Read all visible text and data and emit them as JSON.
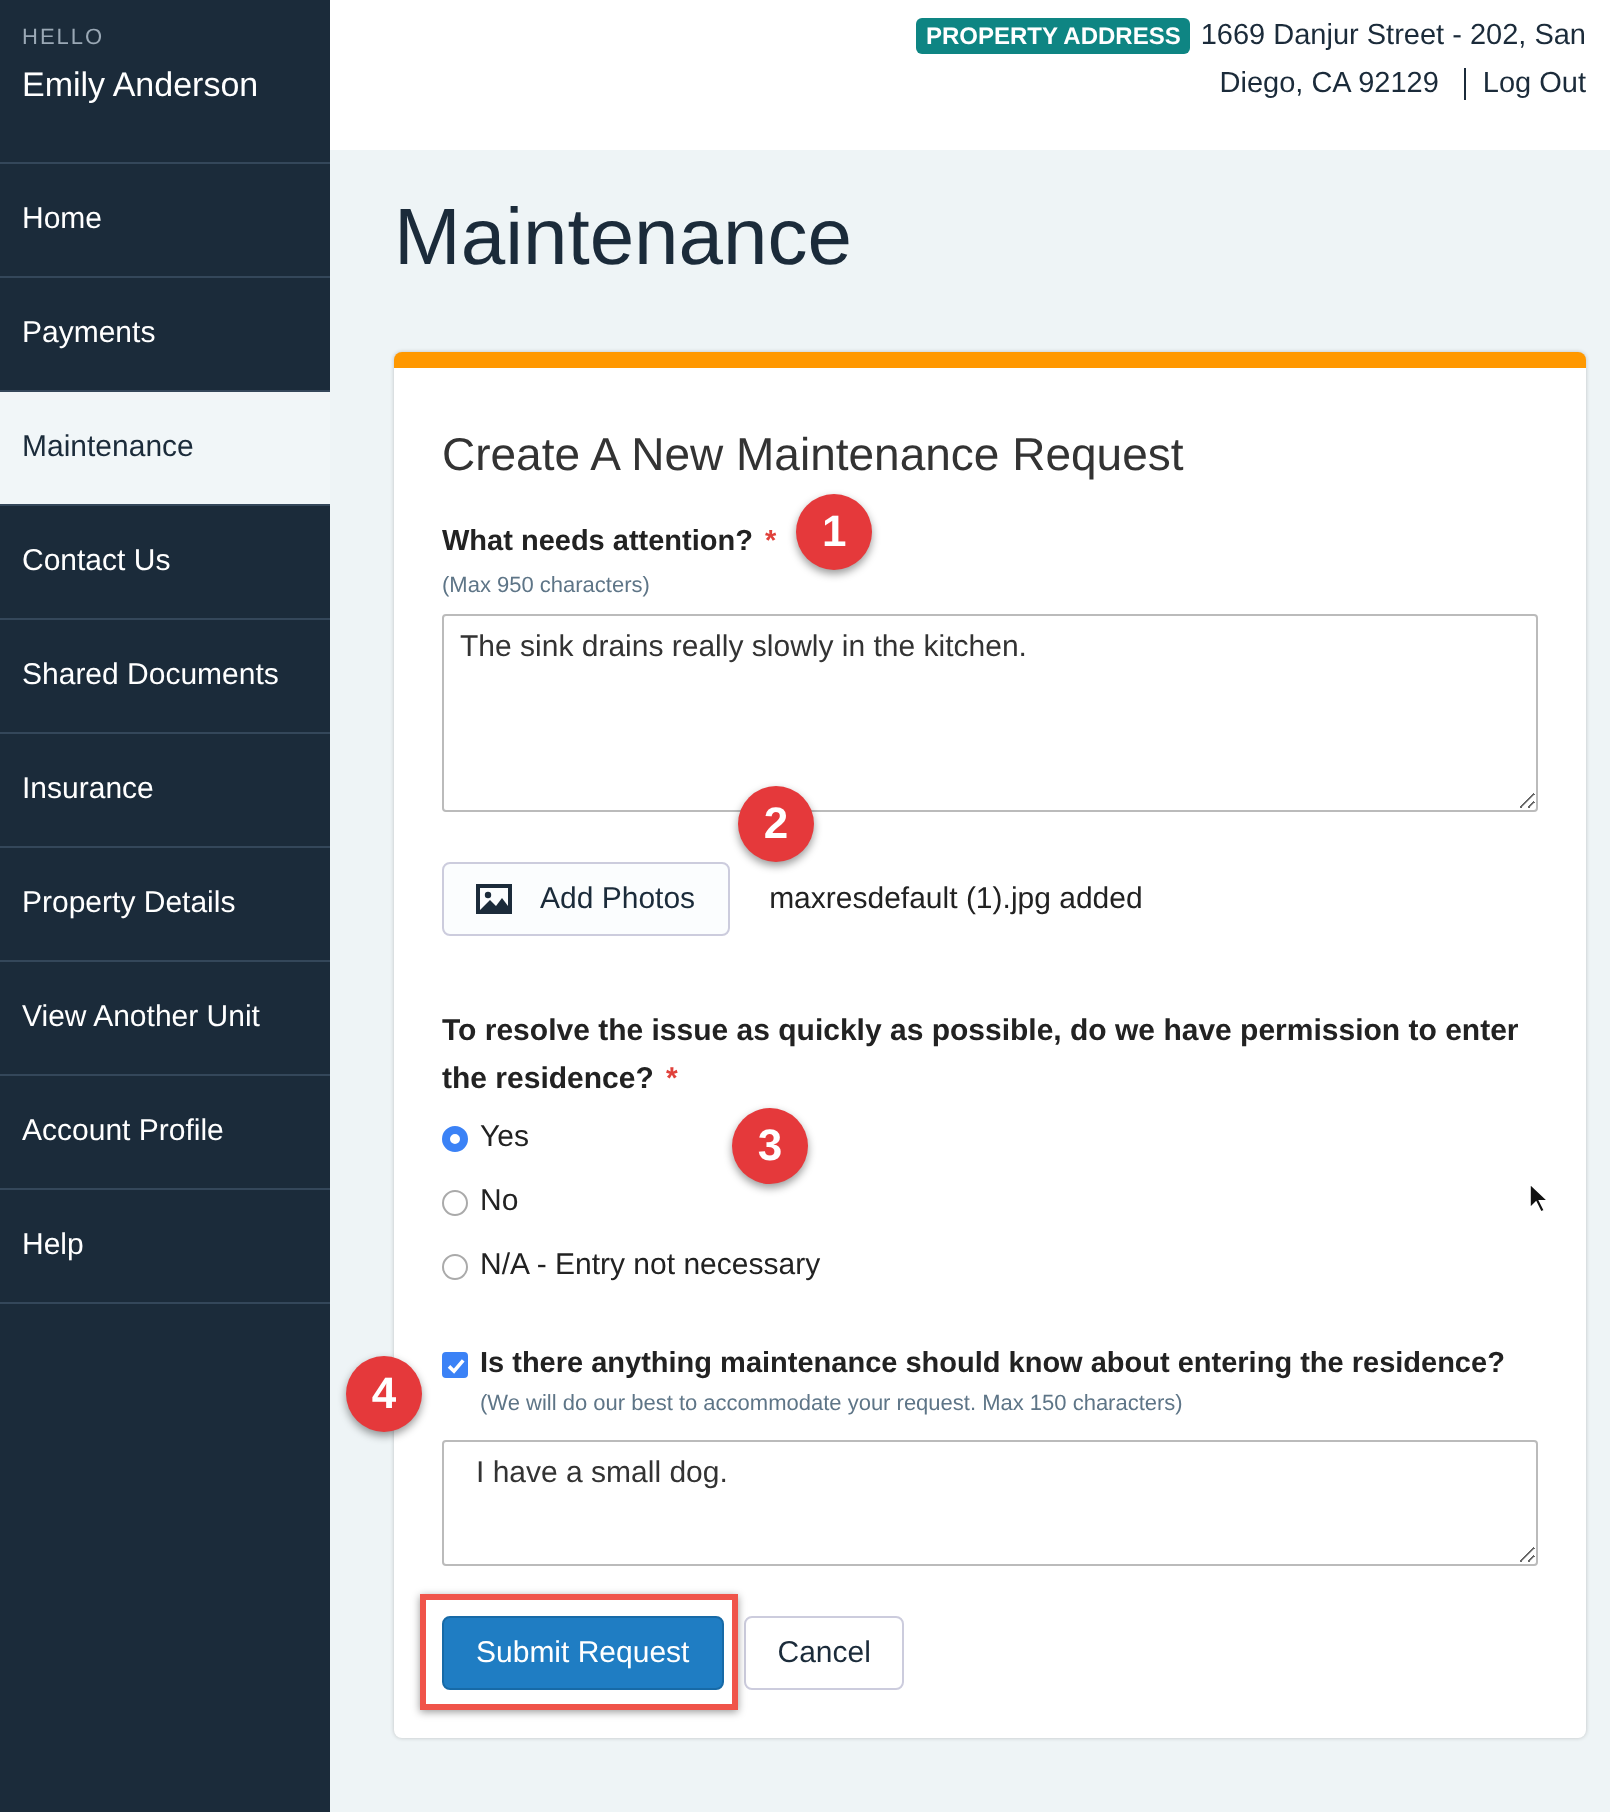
{
  "sidebar": {
    "greeting": "HELLO",
    "user_name": "Emily Anderson",
    "items": [
      {
        "label": "Home",
        "selected": false
      },
      {
        "label": "Payments",
        "selected": false
      },
      {
        "label": "Maintenance",
        "selected": true
      },
      {
        "label": "Contact Us",
        "selected": false
      },
      {
        "label": "Shared Documents",
        "selected": false
      },
      {
        "label": "Insurance",
        "selected": false
      },
      {
        "label": "Property Details",
        "selected": false
      },
      {
        "label": "View Another Unit",
        "selected": false
      },
      {
        "label": "Account Profile",
        "selected": false
      },
      {
        "label": "Help",
        "selected": false
      }
    ]
  },
  "header": {
    "badge": "PROPERTY ADDRESS",
    "address_lines": [
      "1669 Danjur Street - 202, San",
      "Diego, CA 92129"
    ],
    "logout": "Log Out"
  },
  "page_title": "Maintenance",
  "form": {
    "title": "Create A New Maintenance Request",
    "issue": {
      "label": "What needs attention?",
      "required_mark": "*",
      "hint": "(Max 950 characters)",
      "value": "The sink drains really slowly in the kitchen.",
      "annotation": "1"
    },
    "photos": {
      "button": "Add Photos",
      "status": "maxresdefault (1).jpg added",
      "annotation": "2"
    },
    "entry": {
      "label": "To resolve the issue as quickly as possible, do we have permission to enter the residence?",
      "required_mark": "*",
      "annotation": "3",
      "options": [
        {
          "label": "Yes",
          "selected": true
        },
        {
          "label": "No",
          "selected": false
        },
        {
          "label": "N/A - Entry not necessary",
          "selected": false
        }
      ]
    },
    "notes": {
      "checked": true,
      "label": "Is there anything maintenance should know about entering the residence?",
      "hint": "(We will do our best to accommodate your request. Max 150 characters)",
      "value": "I have a small dog.",
      "annotation": "4"
    },
    "buttons": [
      {
        "label": "Submit Request",
        "kind": "primary",
        "highlighted": true
      },
      {
        "label": "Cancel",
        "kind": "secondary",
        "highlighted": false
      }
    ]
  }
}
